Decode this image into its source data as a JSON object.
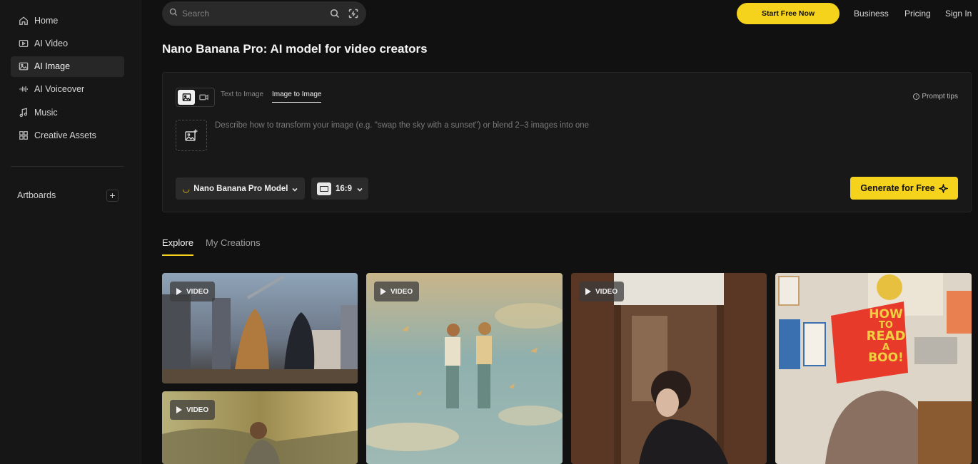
{
  "sidebar": {
    "items": [
      {
        "label": "Home",
        "icon": "home-icon"
      },
      {
        "label": "AI Video",
        "icon": "video-icon"
      },
      {
        "label": "AI Image",
        "icon": "image-icon",
        "active": true
      },
      {
        "label": "AI Voiceover",
        "icon": "waveform-icon"
      },
      {
        "label": "Music",
        "icon": "music-note-icon"
      },
      {
        "label": "Creative Assets",
        "icon": "grid-icon"
      }
    ],
    "artboards_label": "Artboards",
    "add_symbol": "+"
  },
  "topbar": {
    "search_placeholder": "Search",
    "start_button": "Start Free Now",
    "links": [
      "Business",
      "Pricing",
      "Sign In"
    ]
  },
  "page": {
    "title": "Nano Banana Pro: AI model for video creators"
  },
  "panel": {
    "tabs": [
      "Text to Image",
      "Image to Image"
    ],
    "active_tab": "Image to Image",
    "prompt_tips": "Prompt tips",
    "prompt_placeholder": "Describe how to transform your image (e.g. \"swap the sky with a sunset\") or blend 2–3 images into one",
    "model_label": "Nano Banana Pro Model",
    "ratio_label": "16:9",
    "generate_label": "Generate for Free"
  },
  "gallery": {
    "tabs": [
      "Explore",
      "My Creations"
    ],
    "active_tab": "Explore",
    "badge_label": "VIDEO",
    "cards": [
      {
        "badge": "VIDEO",
        "subject": "kaiju-battle-city"
      },
      {
        "badge": "VIDEO",
        "subject": "floating-couple-sky"
      },
      {
        "badge": "VIDEO",
        "subject": "woman-doorway"
      },
      {
        "badge": "",
        "subject": "how-to-read-a-book"
      },
      {
        "badge": "VIDEO",
        "subject": "running-woman"
      }
    ],
    "book_cover_text": [
      "HOW",
      "TO",
      "READ",
      "A",
      "BOO!"
    ]
  },
  "colors": {
    "accent": "#f5d21c",
    "background": "#111111",
    "sidebar": "#161616",
    "panel": "#181818"
  }
}
